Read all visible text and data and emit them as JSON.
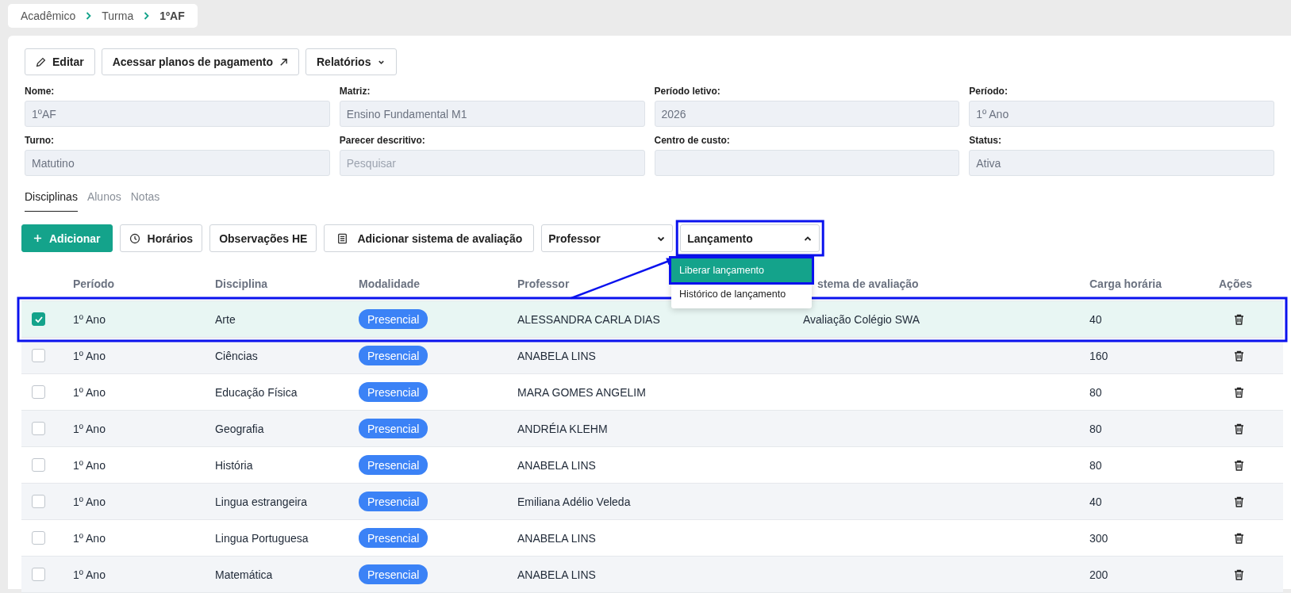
{
  "breadcrumb": [
    "Acadêmico",
    "Turma",
    "1ºAF"
  ],
  "actions": [
    {
      "label": "Editar",
      "kind": "pencil"
    },
    {
      "label": "Acessar planos de pagamento",
      "kind": "external"
    },
    {
      "label": "Relatórios",
      "kind": "dropdown"
    }
  ],
  "fields": [
    {
      "label": "Nome:",
      "value": "1ºAF"
    },
    {
      "label": "Matriz:",
      "value": "Ensino Fundamental M1"
    },
    {
      "label": "Período letivo:",
      "value": "2026"
    },
    {
      "label": "Período:",
      "value": "1º Ano"
    },
    {
      "label": "Turno:",
      "value": "Matutino"
    },
    {
      "label": "Parecer descritivo:",
      "placeholder": "Pesquisar"
    },
    {
      "label": "Centro de custo:"
    },
    {
      "label": "Status:",
      "value": "Ativa"
    }
  ],
  "tabs": [
    {
      "label": "Disciplinas",
      "selected": true
    },
    {
      "label": "Alunos",
      "selected": false
    },
    {
      "label": "Notas",
      "selected": false
    }
  ],
  "toolbar": [
    {
      "label": "Adicionar",
      "kind": "primary"
    },
    {
      "label": "Horários",
      "kind": "clock"
    },
    {
      "label": "Observações HE",
      "kind": "plain"
    },
    {
      "label": "Adicionar sistema de avaliação",
      "kind": "document"
    }
  ],
  "selects": [
    {
      "label": "Professor",
      "expanded": false
    },
    {
      "label": "Lançamento",
      "expanded": true
    }
  ],
  "dropdown_menu": [
    {
      "label": "Liberar lançamento",
      "selected": true
    },
    {
      "label": "Histórico de lançamento",
      "selected": false
    }
  ],
  "table": {
    "columns": [
      "Período",
      "Disciplina",
      "Modalidade",
      "Professor",
      "stema de avaliação",
      "Carga horária",
      "Ações"
    ],
    "rows": [
      {
        "checked": true,
        "periodo": "1º Ano",
        "disciplina": "Arte",
        "modalidade": "Presencial",
        "professor": "ALESSANDRA CARLA DIAS",
        "sistema": "Avaliação Colégio SWA",
        "carga": "40"
      },
      {
        "checked": false,
        "periodo": "1º Ano",
        "disciplina": "Ciências",
        "modalidade": "Presencial",
        "professor": "ANABELA LINS",
        "carga": "160"
      },
      {
        "checked": false,
        "periodo": "1º Ano",
        "disciplina": "Educação Física",
        "modalidade": "Presencial",
        "professor": "MARA GOMES ANGELIM",
        "carga": "80"
      },
      {
        "checked": false,
        "periodo": "1º Ano",
        "disciplina": "Geografia",
        "modalidade": "Presencial",
        "professor": "ANDRÉIA KLEHM",
        "carga": "80"
      },
      {
        "checked": false,
        "periodo": "1º Ano",
        "disciplina": "História",
        "modalidade": "Presencial",
        "professor": "ANABELA LINS",
        "carga": "80"
      },
      {
        "checked": false,
        "periodo": "1º Ano",
        "disciplina": "Lingua estrangeira",
        "modalidade": "Presencial",
        "professor": "Emiliana Adélio Veleda",
        "carga": "40"
      },
      {
        "checked": false,
        "periodo": "1º Ano",
        "disciplina": "Lingua Portuguesa",
        "modalidade": "Presencial",
        "professor": "ANABELA LINS",
        "carga": "300"
      },
      {
        "checked": false,
        "periodo": "1º Ano",
        "disciplina": "Matemática",
        "modalidade": "Presencial",
        "professor": "ANABELA LINS",
        "carga": "200"
      }
    ]
  }
}
